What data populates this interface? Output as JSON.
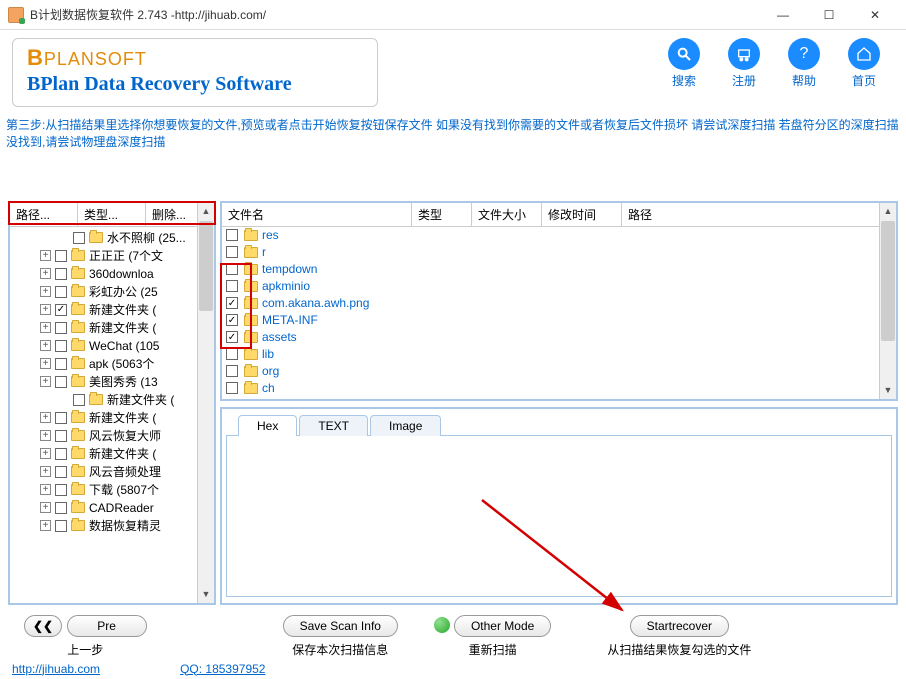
{
  "window": {
    "title": "B计划数据恢复软件 2.743 -http://jihuab.com/"
  },
  "logo": {
    "line1_b": "B",
    "line1_rest": "PLANSOFT",
    "line2": "BPlan Data Recovery Software"
  },
  "topnav": {
    "search": "搜索",
    "register": "注册",
    "help": "帮助",
    "home": "首页"
  },
  "instruction": "第三步:从扫描结果里选择你想要恢复的文件,预览或者点击开始恢复按钮保存文件 如果没有找到你需要的文件或者恢复后文件损坏 请尝试深度扫描 若盘符分区的深度扫描没找到,请尝试物理盘深度扫描",
  "left_header": {
    "col1": "路径...",
    "col2": "类型...",
    "col3": "删除..."
  },
  "tree": [
    {
      "label": "水不照柳 (25...",
      "checked": false,
      "sub": true,
      "exp": true,
      "noexp": true
    },
    {
      "label": "正正正 (7个文",
      "checked": false,
      "exp": true
    },
    {
      "label": "360downloa",
      "checked": false,
      "exp": true
    },
    {
      "label": "彩虹办公 (25",
      "checked": false,
      "exp": true
    },
    {
      "label": "新建文件夹 (",
      "checked": true,
      "exp": true
    },
    {
      "label": "新建文件夹 (",
      "checked": false,
      "exp": true
    },
    {
      "label": "WeChat (105",
      "checked": false,
      "exp": true
    },
    {
      "label": "apk (5063个",
      "checked": false,
      "exp": true
    },
    {
      "label": "美图秀秀 (13",
      "checked": false,
      "exp": true
    },
    {
      "label": "新建文件夹 (",
      "checked": false,
      "sub": true,
      "noexp": true
    },
    {
      "label": "新建文件夹 (",
      "checked": false,
      "exp": true
    },
    {
      "label": "风云恢复大师",
      "checked": false,
      "exp": true
    },
    {
      "label": "新建文件夹 (",
      "checked": false,
      "exp": true
    },
    {
      "label": "风云音频处理",
      "checked": false,
      "exp": true
    },
    {
      "label": "下载 (5807个",
      "checked": false,
      "exp": true
    },
    {
      "label": "CADReader",
      "checked": false,
      "exp": true
    },
    {
      "label": "数据恢复精灵",
      "checked": false,
      "exp": true
    }
  ],
  "file_header": {
    "name": "文件名",
    "type": "类型",
    "size": "文件大小",
    "time": "修改时间",
    "path": "路径"
  },
  "files": [
    {
      "name": "res",
      "checked": false
    },
    {
      "name": "r",
      "checked": false
    },
    {
      "name": "tempdown",
      "checked": false
    },
    {
      "name": "apkminio",
      "checked": false
    },
    {
      "name": "com.akana.awh.png",
      "checked": true
    },
    {
      "name": "META-INF",
      "checked": true
    },
    {
      "name": "assets",
      "checked": true
    },
    {
      "name": "lib",
      "checked": false
    },
    {
      "name": "org",
      "checked": false
    },
    {
      "name": "ch",
      "checked": false
    }
  ],
  "preview_tabs": {
    "hex": "Hex",
    "text": "TEXT",
    "image": "Image"
  },
  "bottom": {
    "pre": "Pre",
    "pre_sub": "上一步",
    "save": "Save Scan Info",
    "save_sub": "保存本次扫描信息",
    "other": "Other Mode",
    "other_sub": "重新扫描",
    "recover": "Startrecover",
    "recover_sub": "从扫描结果恢复勾选的文件"
  },
  "footer": {
    "link1": "http://jihuab.com",
    "link2": "QQ: 185397952"
  }
}
